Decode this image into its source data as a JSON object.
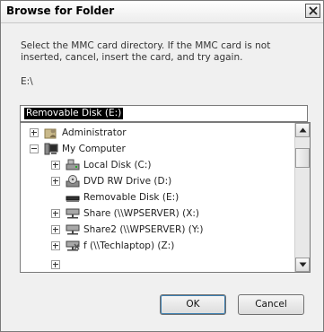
{
  "dialog": {
    "title": "Browse for Folder",
    "instructions": "Select the MMC card directory.  If the MMC card is not inserted, cancel, insert the card, and try again.",
    "current_path": "E:\\",
    "folder_field_value": "Removable Disk (E:)"
  },
  "tree": {
    "items": [
      {
        "label": "Administrator",
        "icon": "user-folder-icon",
        "expander": "plus"
      },
      {
        "label": "My Computer",
        "icon": "computer-icon",
        "expander": "minus"
      },
      {
        "label": "Local Disk (C:)",
        "icon": "hard-disk-icon",
        "expander": "plus"
      },
      {
        "label": "DVD RW Drive (D:)",
        "icon": "dvd-drive-icon",
        "expander": "plus"
      },
      {
        "label": "Removable Disk (E:)",
        "icon": "removable-disk-icon",
        "expander": "none"
      },
      {
        "label": "Share (\\\\WPSERVER) (X:)",
        "icon": "network-drive-icon",
        "expander": "plus"
      },
      {
        "label": "Share2 (\\\\WPSERVER) (Y:)",
        "icon": "network-drive-icon",
        "expander": "plus"
      },
      {
        "label": "f (\\\\Techlaptop) (Z:)",
        "icon": "network-drive-disconnected-icon",
        "expander": "plus"
      }
    ]
  },
  "buttons": {
    "ok": "OK",
    "cancel": "Cancel"
  }
}
